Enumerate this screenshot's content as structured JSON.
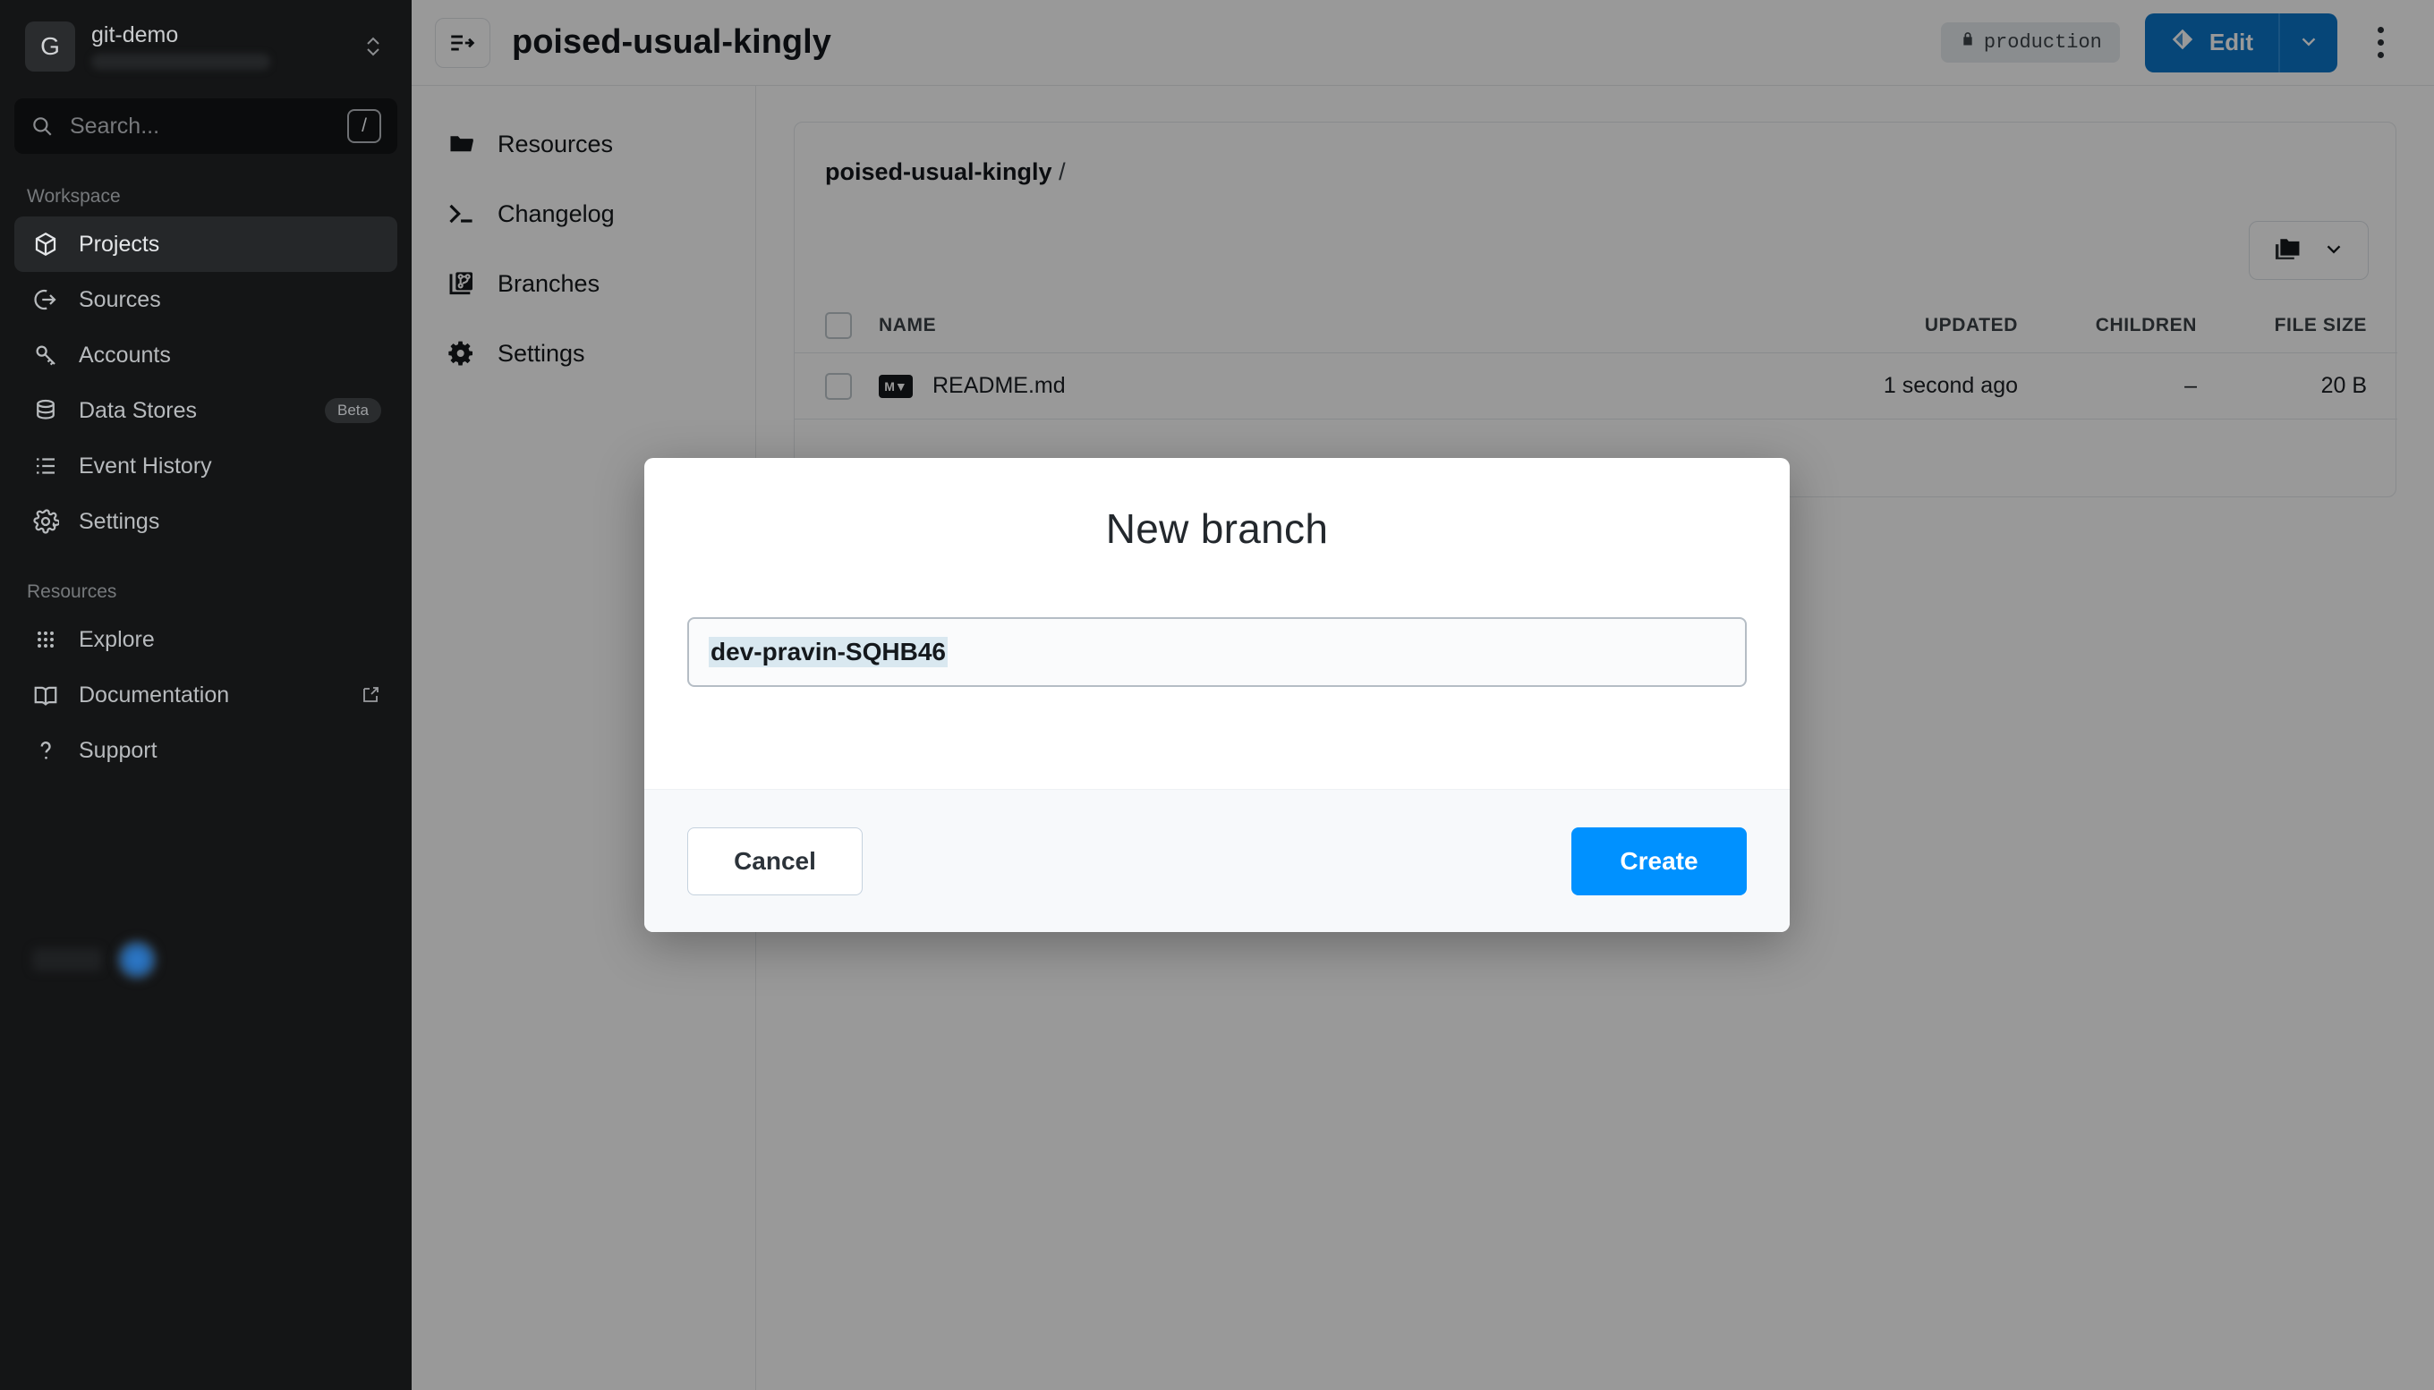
{
  "sidebar": {
    "workspace": {
      "logo_letter": "G",
      "name": "git-demo",
      "switcher_icon": "chevron-up-down-icon"
    },
    "search": {
      "placeholder": "Search...",
      "shortcut": "/",
      "icon": "search-icon"
    },
    "groups": [
      {
        "label": "Workspace",
        "items": [
          {
            "label": "Projects",
            "icon": "cube-icon",
            "active": true
          },
          {
            "label": "Sources",
            "icon": "sources-icon",
            "active": false
          },
          {
            "label": "Accounts",
            "icon": "key-icon",
            "active": false
          },
          {
            "label": "Data Stores",
            "icon": "database-icon",
            "active": false,
            "badge": "Beta"
          },
          {
            "label": "Event History",
            "icon": "list-icon",
            "active": false
          },
          {
            "label": "Settings",
            "icon": "gear-icon",
            "active": false
          }
        ]
      },
      {
        "label": "Resources",
        "items": [
          {
            "label": "Explore",
            "icon": "grid-dots-icon",
            "active": false
          },
          {
            "label": "Documentation",
            "icon": "book-icon",
            "active": false,
            "external": true
          },
          {
            "label": "Support",
            "icon": "question-icon",
            "active": false
          }
        ]
      }
    ]
  },
  "header": {
    "project_icon": "project-flow-icon",
    "title": "poised-usual-kingly",
    "env_badge": {
      "label": "production",
      "icon": "lock-icon"
    },
    "edit_button": {
      "label": "Edit",
      "icon": "branch-diamond-icon"
    },
    "edit_caret_icon": "chevron-down-icon",
    "more_icon": "kebab-menu-icon"
  },
  "project_nav": {
    "items": [
      {
        "label": "Resources",
        "icon": "folder-icon"
      },
      {
        "label": "Changelog",
        "icon": "terminal-icon"
      },
      {
        "label": "Branches",
        "icon": "branches-icon"
      },
      {
        "label": "Settings",
        "icon": "gear-icon"
      }
    ]
  },
  "content": {
    "breadcrumb": {
      "root": "poised-usual-kingly",
      "separator": "/"
    },
    "folder_button": {
      "icon": "folder-add-icon",
      "caret": "chevron-down-icon"
    },
    "table": {
      "columns": [
        "NAME",
        "UPDATED",
        "CHILDREN",
        "FILE SIZE"
      ],
      "rows": [
        {
          "name": "README.md",
          "icon": "markdown-icon",
          "updated": "1 second ago",
          "children": "–",
          "file_size": "20 B"
        }
      ]
    }
  },
  "modal": {
    "title": "New branch",
    "input": {
      "value": "dev-pravin-SQHB46",
      "selected": true
    },
    "cancel_label": "Cancel",
    "create_label": "Create"
  },
  "colors": {
    "sidebar_bg": "#141516",
    "accent_blue": "#0091ff",
    "edit_blue": "#0b75c9",
    "selection_blue": "#d9e8f0",
    "overlay": "rgba(0,0,0,0.40)"
  }
}
